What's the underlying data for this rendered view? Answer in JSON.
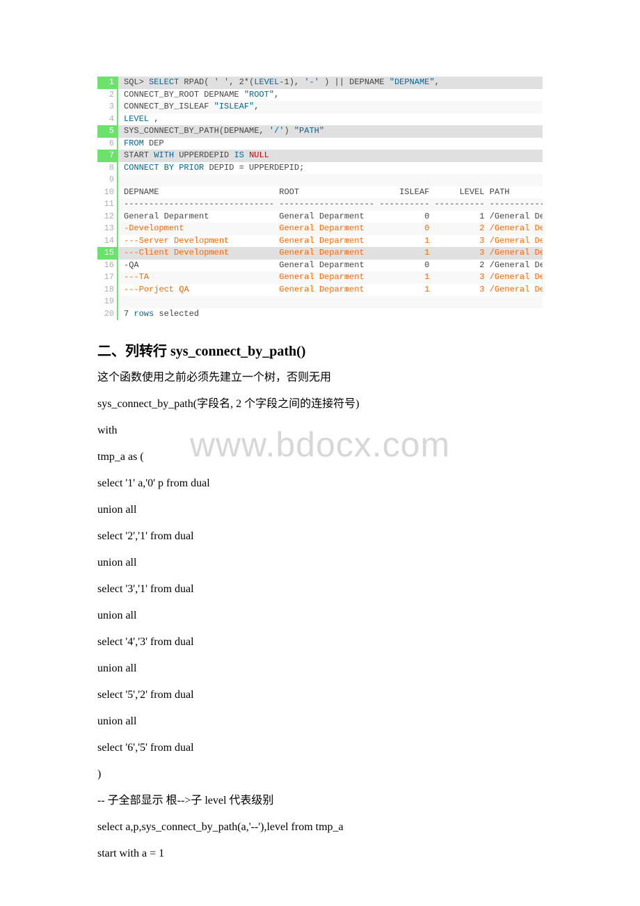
{
  "watermark": "www.bdocx.com",
  "code_lines": [
    {
      "n": "1",
      "hl": true,
      "tokens": [
        [
          "gray",
          "SQL> "
        ],
        [
          "blue",
          "SELECT"
        ],
        [
          "gray",
          " RPAD( "
        ],
        [
          "blue",
          "' '"
        ],
        [
          "gray",
          ", 2*("
        ],
        [
          "blue",
          "LEVEL"
        ],
        [
          "gray",
          "-1), "
        ],
        [
          "blue",
          "'-'"
        ],
        [
          "gray",
          " ) || DEPNAME "
        ],
        [
          "blue",
          "\"DEPNAME\""
        ],
        [
          "gray",
          ","
        ]
      ]
    },
    {
      "n": "2",
      "tokens": [
        [
          "gray",
          "CONNECT_BY_ROOT DEPNAME "
        ],
        [
          "blue",
          "\"ROOT\""
        ],
        [
          "gray",
          ","
        ]
      ]
    },
    {
      "n": "3",
      "tokens": [
        [
          "gray",
          "CONNECT_BY_ISLEAF "
        ],
        [
          "blue",
          "\"ISLEAF\""
        ],
        [
          "gray",
          ","
        ]
      ]
    },
    {
      "n": "4",
      "tokens": [
        [
          "blue",
          "LEVEL"
        ],
        [
          "gray",
          " ,"
        ]
      ]
    },
    {
      "n": "5",
      "hl": true,
      "tokens": [
        [
          "gray",
          "SYS_CONNECT_BY_PATH(DEPNAME, "
        ],
        [
          "blue",
          "'/'"
        ],
        [
          "gray",
          ") "
        ],
        [
          "blue",
          "\"PATH\""
        ]
      ]
    },
    {
      "n": "6",
      "tokens": [
        [
          "blue",
          "FROM"
        ],
        [
          "gray",
          " DEP"
        ]
      ]
    },
    {
      "n": "7",
      "hl": true,
      "tokens": [
        [
          "gray",
          "START "
        ],
        [
          "blue",
          "WITH"
        ],
        [
          "gray",
          " UPPERDEPID "
        ],
        [
          "blue",
          "IS"
        ],
        [
          "gray",
          " "
        ],
        [
          "red",
          "NULL"
        ]
      ]
    },
    {
      "n": "8",
      "tokens": [
        [
          "blue",
          "CONNECT"
        ],
        [
          "gray",
          " "
        ],
        [
          "blue",
          "BY"
        ],
        [
          "gray",
          " "
        ],
        [
          "blue",
          "PRIOR"
        ],
        [
          "gray",
          " DEPID = UPPERDEPID;"
        ]
      ]
    },
    {
      "n": "9",
      "tokens": [
        [
          "gray",
          " "
        ]
      ]
    },
    {
      "n": "10",
      "tokens": [
        [
          "gray",
          "DEPNAME                        ROOT                    ISLEAF      LEVEL PATH"
        ]
      ]
    },
    {
      "n": "11",
      "tokens": [
        [
          "gray",
          "------------------------------ ------------------- ---------- ---------- ------------------------------------------------------"
        ]
      ]
    },
    {
      "n": "12",
      "tokens": [
        [
          "gray",
          "General Deparment              General Deparment            0          1 /General Deparment"
        ]
      ]
    },
    {
      "n": "13",
      "tokens": [
        [
          "orange",
          "-Development                   General Deparment            0          2 /General Deparment/Development"
        ]
      ]
    },
    {
      "n": "14",
      "tokens": [
        [
          "orange",
          "---Server Development          General Deparment            1          3 /General Deparment/Development/Server Development"
        ]
      ]
    },
    {
      "n": "15",
      "hl": true,
      "tokens": [
        [
          "orange",
          "---Client Development          General Deparment            1          3 /General Deparment/Development/Client Development"
        ]
      ]
    },
    {
      "n": "16",
      "tokens": [
        [
          "gray",
          "-QA                            General Deparment            0          2 /General Deparment/QA"
        ]
      ]
    },
    {
      "n": "17",
      "tokens": [
        [
          "orange",
          "---TA                          General Deparment            1          3 /General Deparment/QA/TA"
        ]
      ]
    },
    {
      "n": "18",
      "tokens": [
        [
          "orange",
          "---Porject QA                  General Deparment            1          3 /General Deparment/QA/Porject QA"
        ]
      ]
    },
    {
      "n": "19",
      "tokens": [
        [
          "gray",
          " "
        ]
      ]
    },
    {
      "n": "20",
      "tokens": [
        [
          "gray",
          "7 "
        ],
        [
          "blue",
          "rows"
        ],
        [
          "gray",
          " selected"
        ]
      ]
    }
  ],
  "section_heading": "二、列转行 sys_connect_by_path()",
  "paragraphs": [
    "这个函数使用之前必须先建立一个树，否则无用",
    "sys_connect_by_path(字段名, 2 个字段之间的连接符号)",
    "with",
    "tmp_a as (",
    "select '1' a,'0' p from dual",
    "union all",
    "select '2','1' from dual",
    "union all",
    "select '3','1' from dual",
    "union all",
    "select '4','3' from dual",
    "union all",
    "select '5','2' from dual",
    "union all",
    "select '6','5' from dual",
    ")",
    "-- 子全部显示 根-->子   level 代表级别",
    "select a,p,sys_connect_by_path(a,'--'),level from tmp_a",
    "start with a = 1"
  ]
}
